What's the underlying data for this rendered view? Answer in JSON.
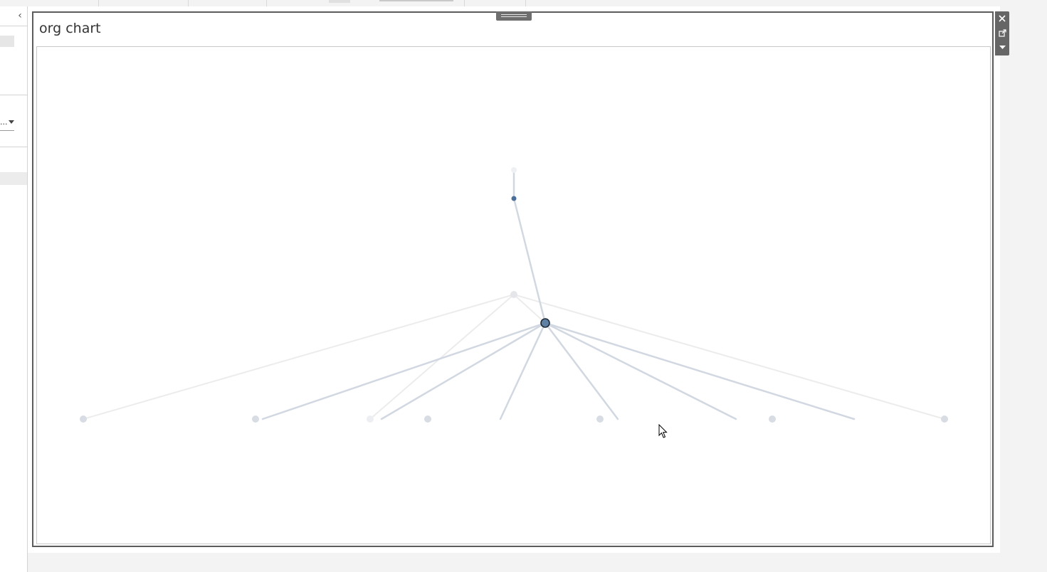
{
  "panel": {
    "title": "org chart"
  },
  "left_panel": {
    "collapse_icon": "chevron-left-icon",
    "dropdown_value": "..."
  },
  "toolbar": {
    "buttons": [
      {
        "icon": "close-icon"
      },
      {
        "icon": "open-external-icon"
      },
      {
        "icon": "caret-down-icon"
      }
    ]
  },
  "colors": {
    "edge": "#d2d8e1",
    "edge_faded": "#ececec",
    "node_faded": "#d8dce3",
    "node_selected": "#5f7fa3",
    "node_top": "#4a6f99",
    "panel_border": "#5c5c5c"
  },
  "chart_data": {
    "type": "tree",
    "nodes": [
      {
        "id": "root",
        "level": 0,
        "state": "faded"
      },
      {
        "id": "n1",
        "level": 1,
        "state": "highlighted"
      },
      {
        "id": "n2",
        "level": 2,
        "state": "faded"
      },
      {
        "id": "n3",
        "level": 3,
        "state": "selected"
      },
      {
        "id": "c1",
        "level": 4,
        "state": "faded"
      },
      {
        "id": "c2",
        "level": 4,
        "state": "faded"
      },
      {
        "id": "c3",
        "level": 4,
        "state": "faded"
      },
      {
        "id": "c4",
        "level": 4,
        "state": "faded"
      },
      {
        "id": "c5",
        "level": 4,
        "state": "faded"
      },
      {
        "id": "c6",
        "level": 4,
        "state": "faded"
      },
      {
        "id": "c7",
        "level": 4,
        "state": "faded"
      }
    ]
  }
}
